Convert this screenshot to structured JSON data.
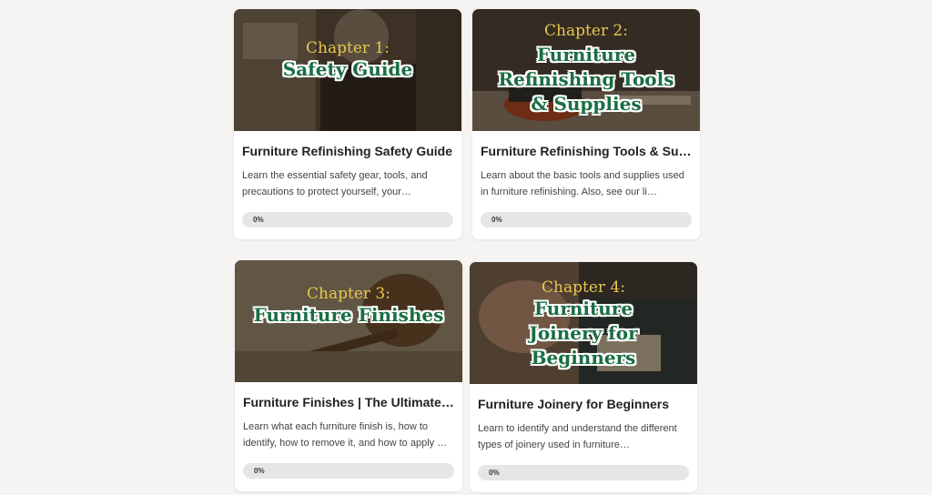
{
  "courses": [
    {
      "chapter": "Chapter 1:",
      "banner_title": "Safety Guide",
      "title": "Furniture Refinishing Safety Guide",
      "description": "Learn the essential safety gear, tools, and precautions to protect yourself, your…",
      "progress": 0,
      "progress_label": "0%"
    },
    {
      "chapter": "Chapter 2:",
      "banner_title": "Furniture Refinishing Tools & Supplies",
      "title": "Furniture Refinishing Tools & Sup…",
      "description": "Learn about the basic tools and supplies used in furniture refinishing. Also, see our li…",
      "progress": 0,
      "progress_label": "0%"
    },
    {
      "chapter": "Chapter 3:",
      "banner_title": "Furniture Finishes",
      "title": "Furniture Finishes | The Ultimate …",
      "description": "Learn what each furniture finish is, how to identify, how to remove it, and how to apply …",
      "progress": 0,
      "progress_label": "0%"
    },
    {
      "chapter": "Chapter 4:",
      "banner_title": "Furniture Joinery for Beginners",
      "title": "Furniture Joinery for Beginners",
      "description": "Learn to identify and understand the different types of joinery used in furniture…",
      "progress": 0,
      "progress_label": "0%"
    }
  ],
  "colors": {
    "page_background": "#f6f4f2",
    "chapter_text": "#e8c64e",
    "banner_title_text": "#1a6e43",
    "progress_track": "#e6e6e6"
  }
}
